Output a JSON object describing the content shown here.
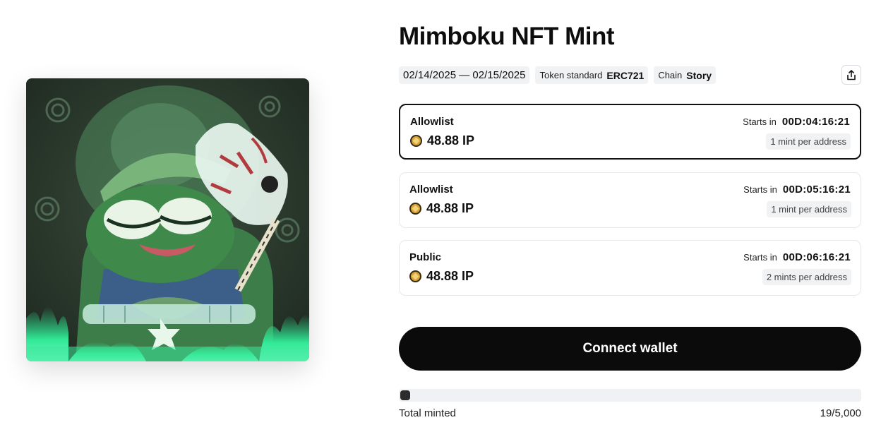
{
  "title": "Mimboku NFT Mint",
  "meta": {
    "dates": "02/14/2025 — 02/15/2025",
    "token_standard_label": "Token standard",
    "token_standard_value": "ERC721",
    "chain_label": "Chain",
    "chain_value": "Story"
  },
  "share_icon": "share-upload-icon",
  "phases": [
    {
      "name": "Allowlist",
      "price": "48.88 IP",
      "starts_label": "Starts in",
      "countdown": "00D:04:16:21",
      "limit": "1 mint per address",
      "active": true
    },
    {
      "name": "Allowlist",
      "price": "48.88 IP",
      "starts_label": "Starts in",
      "countdown": "00D:05:16:21",
      "limit": "1 mint per address",
      "active": false
    },
    {
      "name": "Public",
      "price": "48.88 IP",
      "starts_label": "Starts in",
      "countdown": "00D:06:16:21",
      "limit": "2 mints per address",
      "active": false
    }
  ],
  "connect_button": "Connect wallet",
  "progress": {
    "label": "Total minted",
    "count": "19/5,000",
    "fraction": 0.0038
  },
  "colors": {
    "button_bg": "#0b0b0b",
    "active_border": "#111111",
    "coin": "#d6a53a",
    "art_bg": "#2a3a2c",
    "art_flame": "#3df0a0"
  }
}
